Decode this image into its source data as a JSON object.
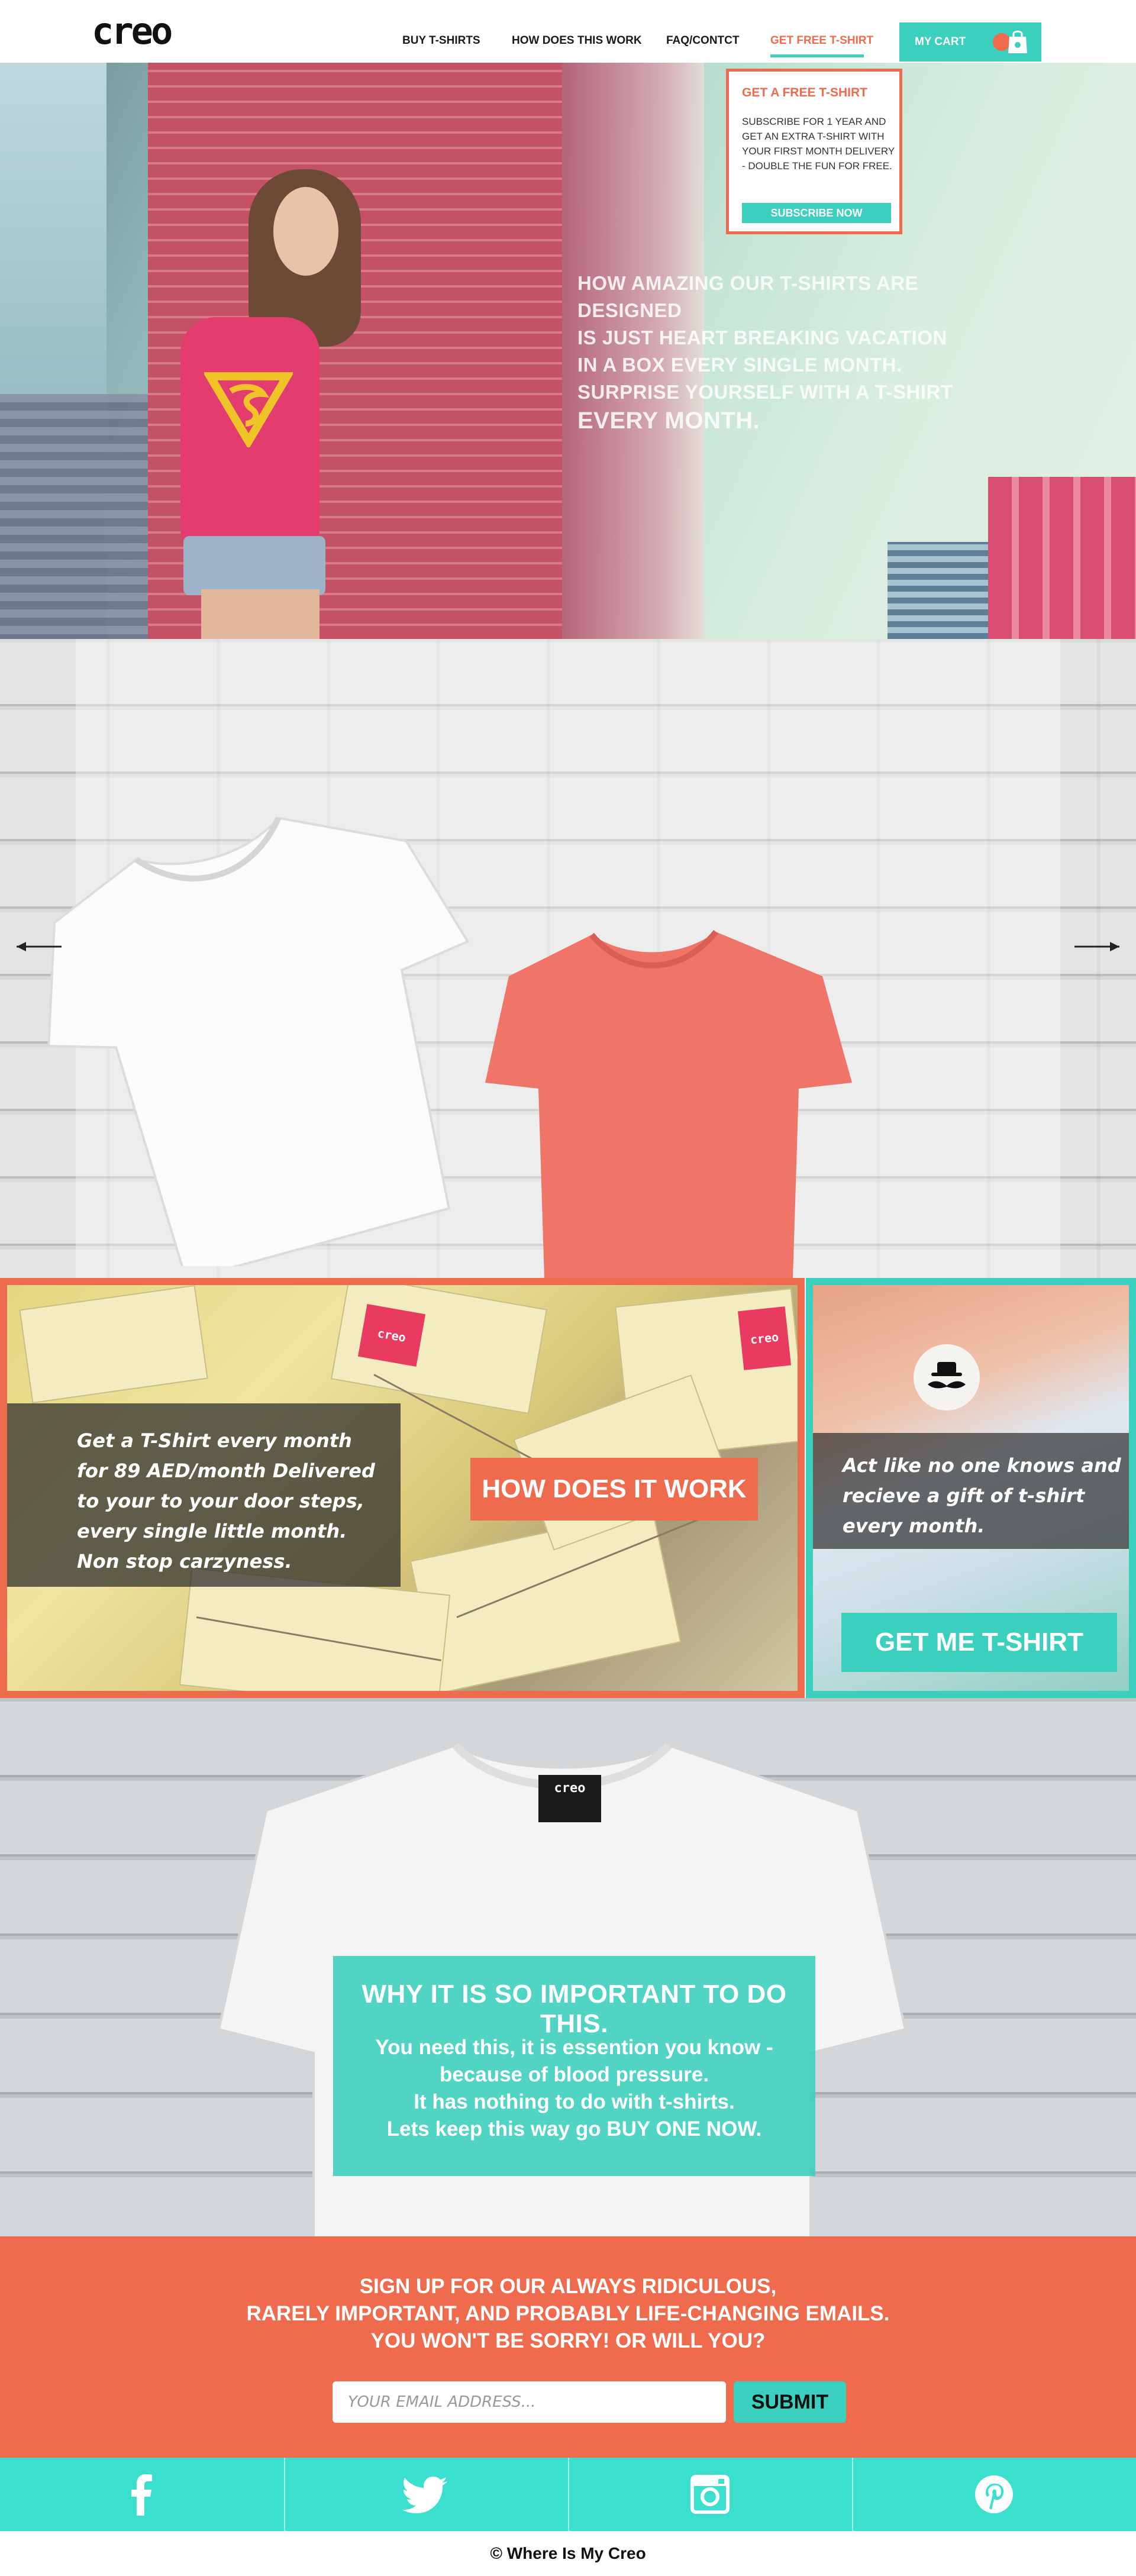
{
  "header": {
    "logo": "creo",
    "nav": [
      {
        "label": "BUY T-SHIRTS"
      },
      {
        "label": "HOW DOES THIS WORK"
      },
      {
        "label": "FAQ/CONTCT"
      },
      {
        "label": "GET FREE T-SHIRT"
      }
    ],
    "active_nav": "GET FREE T-SHIRT",
    "cart_label": "MY CART",
    "cart_icon": "shopping-bag-icon"
  },
  "promo_box": {
    "title": "GET A FREE T-SHIRT",
    "text": "SUBSCRIBE FOR 1 YEAR AND GET AN EXTRA T-SHIRT WITH YOUR FIRST MONTH DELIVERY - DOUBLE THE FUN FOR FREE.",
    "button": "SUBSCRIBE NOW"
  },
  "hero": {
    "lines": [
      "HOW AMAZING OUR T-SHIRTS ARE DESIGNED",
      "IS JUST HEART BREAKING VACATION",
      "IN A BOX EVERY SINGLE MONTH.",
      "SURPRISE YOURSELF WITH A T-SHIRT",
      "EVERY MONTH."
    ]
  },
  "slider": {
    "prev_icon": "arrow-left-icon",
    "next_icon": "arrow-right-icon"
  },
  "feature_left": {
    "text": "Get a T-Shirt every month for 89 AED/month Delivered to your to your door steps, every single little month. Non  stop carzyness.",
    "button": "HOW DOES IT WORK",
    "box_tag": "creo"
  },
  "feature_right": {
    "text": "Act like no one knows and recieve a gift of t-shirt every month.",
    "button": "GET ME T-SHIRT"
  },
  "important": {
    "tee_label": "creo",
    "title": "WHY IT IS SO IMPORTANT TO DO THIS.",
    "body": [
      "You need this, it is essention you know -",
      "because of blood pressure.",
      "It has nothing to do with t-shirts.",
      "Lets keep this way go BUY ONE NOW."
    ]
  },
  "signup": {
    "lines": [
      "SIGN UP FOR OUR ALWAYS RIDICULOUS,",
      "RARELY IMPORTANT, AND PROBABLY LIFE-CHANGING EMAILS.",
      "YOU WON'T BE SORRY! OR WILL YOU?"
    ],
    "placeholder": "YOUR EMAIL ADDRESS...",
    "submit": "SUBMIT"
  },
  "social": [
    {
      "icon": "facebook-icon"
    },
    {
      "icon": "twitter-icon"
    },
    {
      "icon": "instagram-icon"
    },
    {
      "icon": "pinterest-icon"
    }
  ],
  "footer": {
    "text": "© Where Is My Creo"
  },
  "colors": {
    "coral": "#ef6b4e",
    "teal": "#3bcfbe",
    "social_bar": "#3bdfcd"
  }
}
